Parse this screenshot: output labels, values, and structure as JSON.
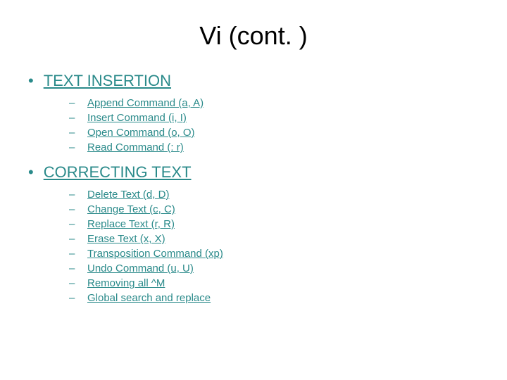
{
  "title": "Vi (cont. )",
  "sections": [
    {
      "heading": "TEXT INSERTION",
      "items": [
        "Append Command (a, A)",
        "Insert Command (i, I)",
        "Open Command (o, O)",
        "Read Command (: r)"
      ]
    },
    {
      "heading": "CORRECTING TEXT",
      "items": [
        "Delete Text (d, D)",
        "Change Text (c, C)",
        "Replace Text (r, R)",
        "Erase Text (x, X)",
        "Transposition Command (xp)",
        "Undo Command (u, U)",
        "Removing all ^M",
        "Global search and replace"
      ]
    }
  ]
}
